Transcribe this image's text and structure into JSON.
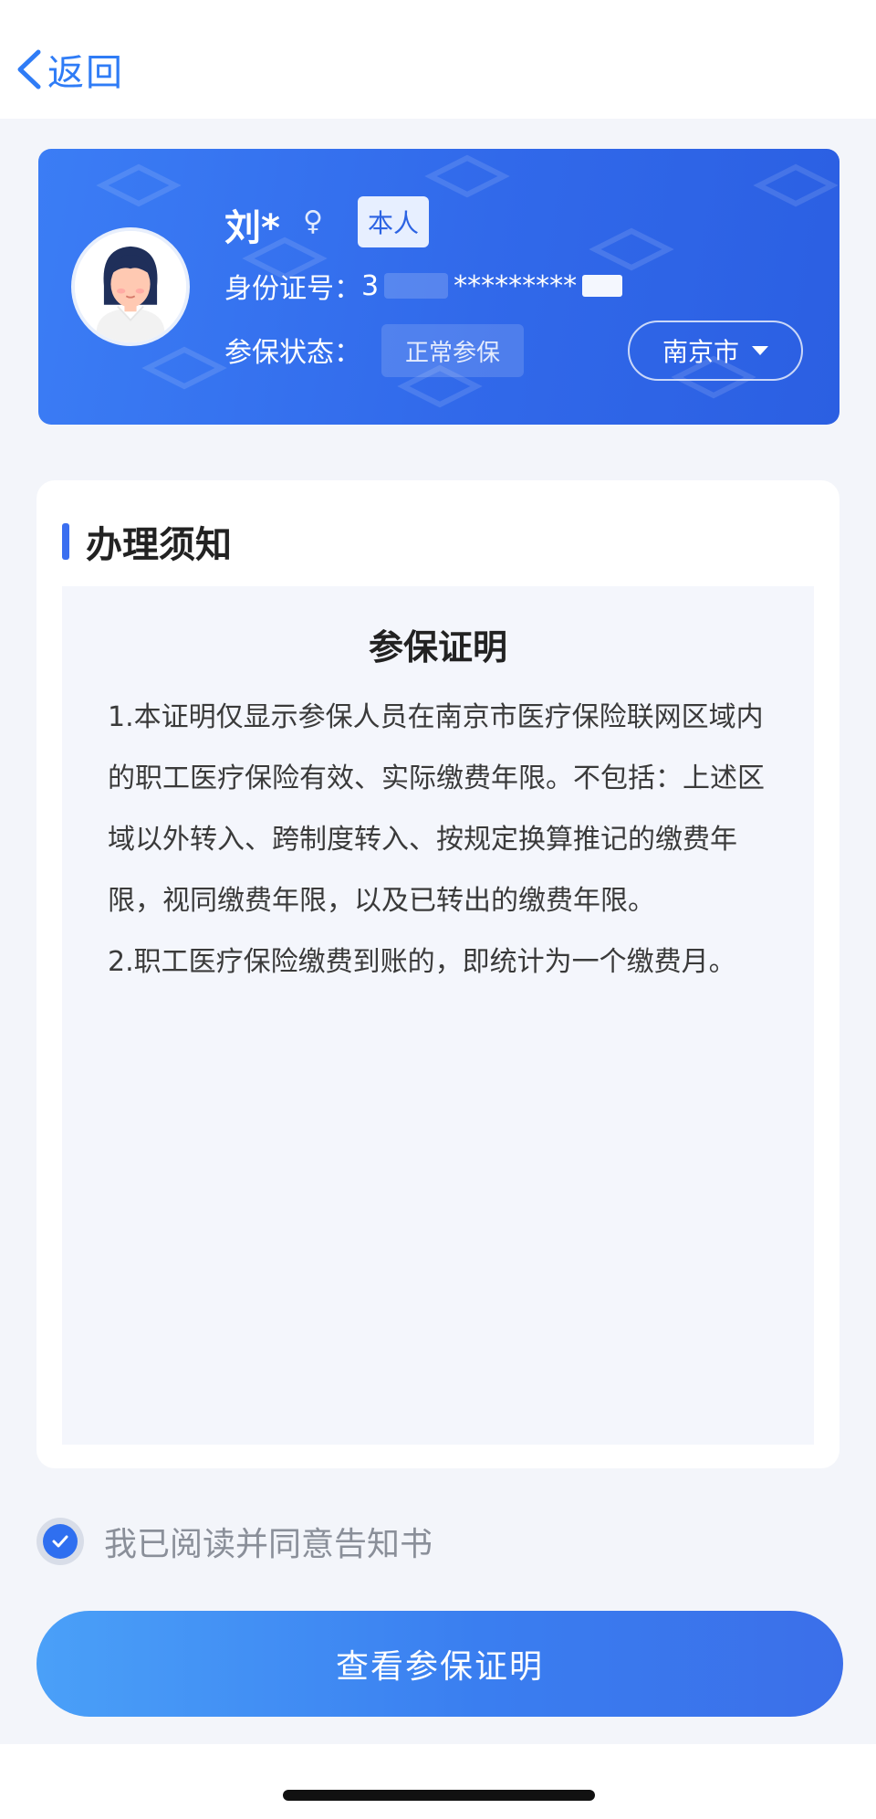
{
  "nav": {
    "back_label": "返回"
  },
  "profile": {
    "name": "刘*",
    "gender_symbol": "♀",
    "self_badge": "本人",
    "id_label": "身份证号：",
    "id_prefix": "3",
    "id_masked": "*********",
    "status_label": "参保状态：",
    "status_value": "正常参保",
    "city": "南京市"
  },
  "notice": {
    "section_title": "办理须知",
    "doc_title": "参保证明",
    "paragraph_1": "1.本证明仅显示参保人员在南京市医疗保险联网区域内的职工医疗保险有效、实际缴费年限。不包括：上述区域以外转入、跨制度转入、按规定换算推记的缴费年限，视同缴费年限，以及已转出的缴费年限。",
    "paragraph_2": "2.职工医疗保险缴费到账的，即统计为一个缴费月。"
  },
  "agreement": {
    "text": "我已阅读并同意告知书",
    "checked": true
  },
  "action": {
    "button_label": "查看参保证明"
  },
  "colors": {
    "primary": "#2f6ff0",
    "card_blue": "#3169ea",
    "back_blue": "#2f7cf6"
  }
}
